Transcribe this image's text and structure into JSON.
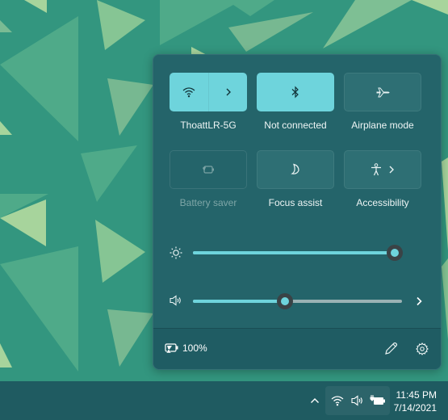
{
  "quick_settings": {
    "tiles": [
      {
        "label": "ThoattLR-5G",
        "icon": "wifi-icon",
        "state": "on",
        "has_chevron": true
      },
      {
        "label": "Not connected",
        "icon": "bluetooth-icon",
        "state": "on",
        "has_chevron": false
      },
      {
        "label": "Airplane mode",
        "icon": "airplane-icon",
        "state": "off",
        "has_chevron": false
      },
      {
        "label": "Battery saver",
        "icon": "battery-saver-icon",
        "state": "disabled",
        "has_chevron": false
      },
      {
        "label": "Focus assist",
        "icon": "moon-icon",
        "state": "off",
        "has_chevron": false
      },
      {
        "label": "Accessibility",
        "icon": "accessibility-icon",
        "state": "off",
        "has_chevron": true
      }
    ],
    "brightness": {
      "icon": "brightness-icon",
      "value_percent": 100
    },
    "volume": {
      "icon": "speaker-icon",
      "value_percent": 44
    },
    "footer": {
      "battery_text": "100%",
      "battery_icon": "battery-charging-icon",
      "edit_icon": "pencil-icon",
      "settings_icon": "gear-icon"
    }
  },
  "taskbar": {
    "overflow_icon": "chevron-up-icon",
    "tray_icons": [
      "wifi-icon",
      "speaker-icon",
      "battery-charging-icon"
    ],
    "time": "11:45 PM",
    "date": "7/14/2021"
  },
  "colors": {
    "accent": "#6ed4dc",
    "panel": "#24646a",
    "wallpaper": "#33967f"
  }
}
